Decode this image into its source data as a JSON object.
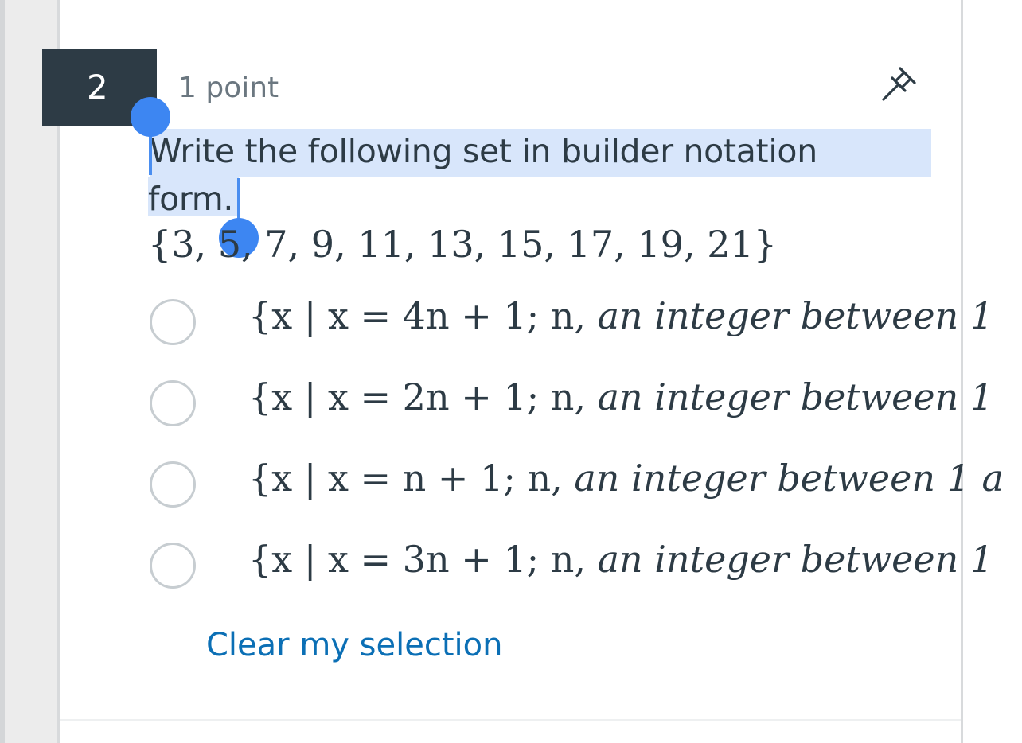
{
  "question": {
    "number": "2",
    "points": "1 point",
    "text_line1": "Write the following set in builder notation",
    "text_line2": "form.",
    "set": "{3, 5, 7, 9, 11, 13, 15, 17, 19, 21}"
  },
  "options": [
    {
      "prefix": "{x | x = 4n + 1; n,",
      "suffix": "an integer between 1"
    },
    {
      "prefix": "{x | x = 2n + 1; n,",
      "suffix": "an integer between 1"
    },
    {
      "prefix": "{x | x = n + 1; n,",
      "suffix": "an integer between 1 a"
    },
    {
      "prefix": "{x | x = 3n + 1; n,",
      "suffix": "an integer between 1"
    }
  ],
  "actions": {
    "clear_label": "Clear my selection"
  },
  "icons": {
    "pin": "pin-icon"
  },
  "colors": {
    "badge_bg": "#2d3b45",
    "text": "#2d3b45",
    "link": "#0b6fb5",
    "selection": "#d8e6fb",
    "selection_handle": "#3d86f2"
  }
}
